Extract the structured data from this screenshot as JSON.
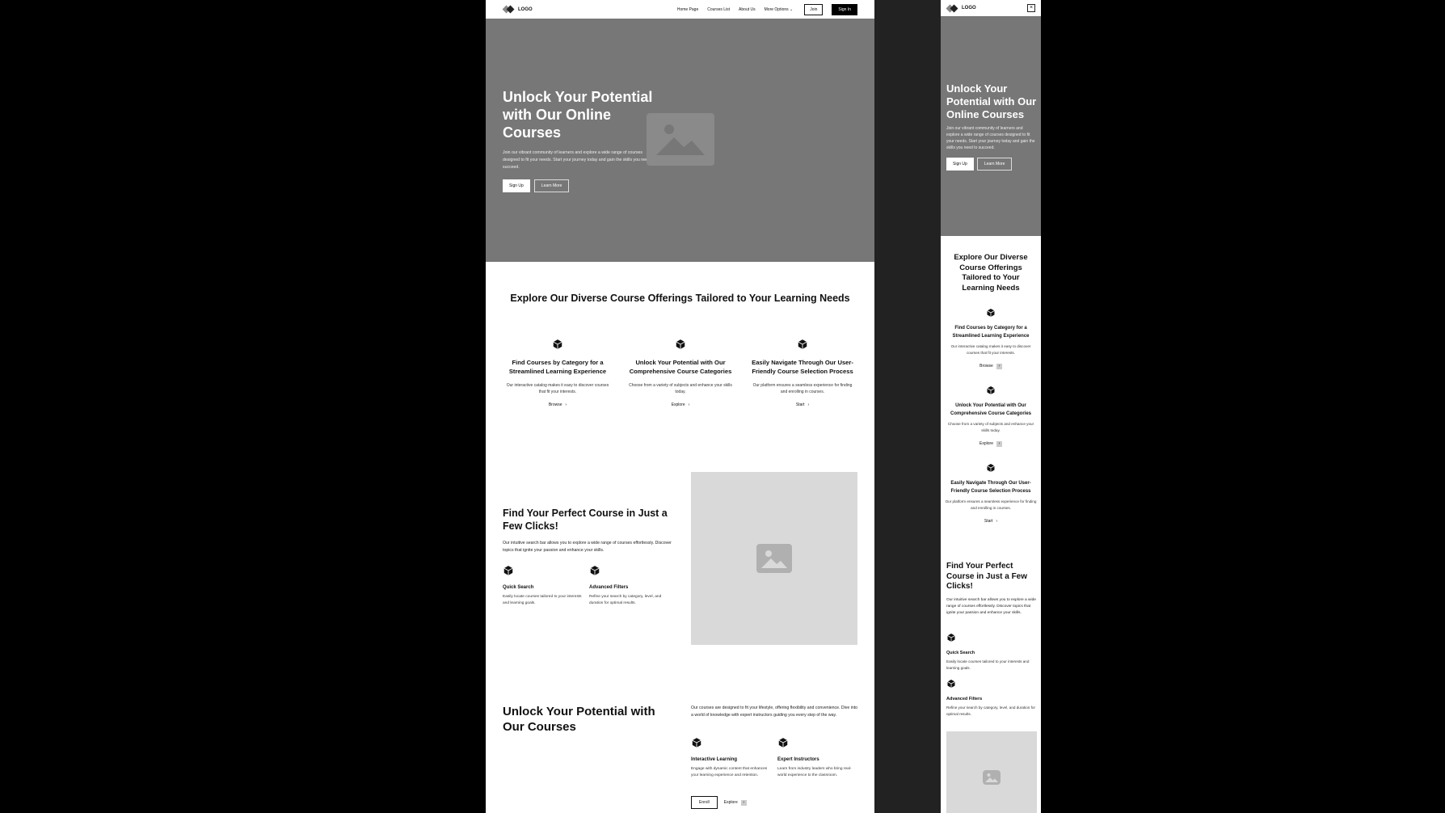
{
  "nav": {
    "logo": "LOGO",
    "links": [
      "Home Page",
      "Courses List",
      "About Us",
      "More Options"
    ],
    "join": "Join",
    "signin": "Sign In"
  },
  "hero": {
    "title": "Unlock Your Potential with Our Online Courses",
    "desc": "Join our vibrant community of learners and explore a wide range of courses designed to fit your needs. Start your journey today and gain the skills you need to succeed.",
    "signup": "Sign Up",
    "learn": "Learn More"
  },
  "features": {
    "title": "Explore Our Diverse Course Offerings Tailored to Your Learning Needs",
    "items": [
      {
        "title": "Find Courses by Category for a Streamlined Learning Experience",
        "desc": "Our interactive catalog makes it easy to discover courses that fit your interests.",
        "link": "Browse"
      },
      {
        "title": "Unlock Your Potential with Our Comprehensive Course Categories",
        "desc": "Choose from a variety of subjects and enhance your skills today.",
        "link": "Explore"
      },
      {
        "title": "Easily Navigate Through Our User-Friendly Course Selection Process",
        "desc": "Our platform ensures a seamless experience for finding and enrolling in courses.",
        "link": "Start"
      }
    ]
  },
  "search": {
    "title": "Find Your Perfect Course in Just a Few Clicks!",
    "desc": "Our intuitive search bar allows you to explore a wide range of courses effortlessly. Discover topics that ignite your passion and enhance your skills.",
    "items": [
      {
        "title": "Quick Search",
        "desc": "Easily locate courses tailored to your interests and learning goals."
      },
      {
        "title": "Advanced Filters",
        "desc": "Refine your search by category, level, and duration for optimal results."
      }
    ]
  },
  "potential": {
    "title": "Unlock Your Potential with Our Courses",
    "desc": "Our courses are designed to fit your lifestyle, offering flexibility and convenience. Dive into a world of knowledge with expert instructors guiding you every step of the way.",
    "items": [
      {
        "title": "Interactive Learning",
        "desc": "Engage with dynamic content that enhances your learning experience and retention."
      },
      {
        "title": "Expert Instructors",
        "desc": "Learn from industry leaders who bring real-world experience to the classroom."
      }
    ],
    "enroll": "Enroll",
    "explore": "Explore"
  },
  "icons": {
    "chevron": "›",
    "close": "×",
    "chevron_down": "⌄"
  }
}
